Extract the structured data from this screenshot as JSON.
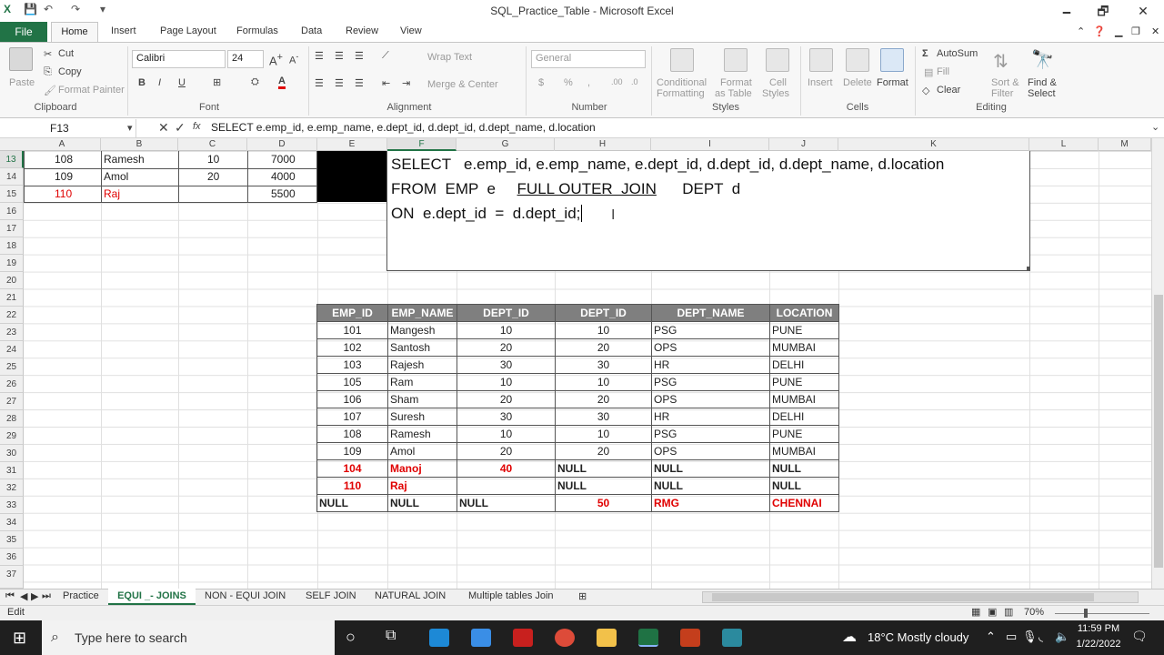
{
  "window": {
    "title": "SQL_Practice_Table - Microsoft Excel",
    "minimize": "🗕",
    "restore": "🗗",
    "close": "✕"
  },
  "ribbon_tabs": [
    "File",
    "Home",
    "Insert",
    "Page Layout",
    "Formulas",
    "Data",
    "Review",
    "View"
  ],
  "clipboard": {
    "paste": "Paste",
    "cut": "Cut",
    "copy": "Copy",
    "format_painter": "Format Painter",
    "label": "Clipboard"
  },
  "font": {
    "name": "Calibri",
    "size": "24",
    "label": "Font"
  },
  "alignment": {
    "wrap_text": "Wrap Text",
    "merge_center": "Merge & Center",
    "label": "Alignment"
  },
  "number": {
    "format": "General",
    "label": "Number"
  },
  "styles": {
    "conditional": "Conditional",
    "conditional2": "Formatting",
    "format_as": "Format",
    "format_as2": "as Table",
    "cell": "Cell",
    "cell2": "Styles",
    "label": "Styles"
  },
  "cells": {
    "insert": "Insert",
    "delete": "Delete",
    "format": "Format",
    "label": "Cells"
  },
  "editing": {
    "autosum": "AutoSum",
    "fill": "Fill",
    "clear": "Clear",
    "sort": "Sort &",
    "sort2": "Filter",
    "find": "Find &",
    "find2": "Select",
    "label": "Editing"
  },
  "formula_bar": {
    "name_box": "F13",
    "formula": "SELECT   e.emp_id, e.emp_name, e.dept_id, d.dept_id, d.dept_name, d.location"
  },
  "columns": [
    "A",
    "B",
    "C",
    "D",
    "E",
    "F",
    "G",
    "H",
    "I",
    "J",
    "K",
    "L",
    "M"
  ],
  "rows": [
    "13",
    "14",
    "15",
    "16",
    "17",
    "18",
    "19",
    "20",
    "21",
    "22",
    "23",
    "24",
    "25",
    "26",
    "27",
    "28",
    "29",
    "30",
    "31",
    "32",
    "33",
    "34",
    "35",
    "36",
    "37"
  ],
  "top_rows": [
    {
      "a": "108",
      "b": "Ramesh",
      "c": "10",
      "d": "7000"
    },
    {
      "a": "109",
      "b": "Amol",
      "c": "20",
      "d": "4000"
    },
    {
      "a": "110",
      "b": "Raj",
      "c": "",
      "d": "5500"
    }
  ],
  "sql": {
    "line1": "SELECT   e.emp_id, e.emp_name, e.dept_id, d.dept_id, d.dept_name, d.location",
    "line2a": "FROM  EMP  e     ",
    "line2b": "FULL OUTER  JOIN",
    "line2c": "      DEPT  d",
    "line3": "ON  e.dept_id  =  d.dept_id;"
  },
  "result_table": {
    "headers": [
      "EMP_ID",
      "EMP_NAME",
      "DEPT_ID",
      "DEPT_ID",
      "DEPT_NAME",
      "LOCATION"
    ],
    "rows": [
      [
        "101",
        "Mangesh",
        "10",
        "10",
        "PSG",
        "PUNE"
      ],
      [
        "102",
        "Santosh",
        "20",
        "20",
        "OPS",
        "MUMBAI"
      ],
      [
        "103",
        "Rajesh",
        "30",
        "30",
        "HR",
        "DELHI"
      ],
      [
        "105",
        "Ram",
        "10",
        "10",
        "PSG",
        "PUNE"
      ],
      [
        "106",
        "Sham",
        "20",
        "20",
        "OPS",
        "MUMBAI"
      ],
      [
        "107",
        "Suresh",
        "30",
        "30",
        "HR",
        "DELHI"
      ],
      [
        "108",
        "Ramesh",
        "10",
        "10",
        "PSG",
        "PUNE"
      ],
      [
        "109",
        "Amol",
        "20",
        "20",
        "OPS",
        "MUMBAI"
      ],
      [
        "104",
        "Manoj",
        "40",
        "NULL",
        "NULL",
        "NULL"
      ],
      [
        "110",
        "Raj",
        "",
        "NULL",
        "NULL",
        "NULL"
      ],
      [
        "NULL",
        "NULL",
        "NULL",
        "50",
        "RMG",
        "CHENNAI"
      ]
    ]
  },
  "sheet_tabs": [
    "Practice",
    "EQUI _- JOINS",
    "NON - EQUI  JOIN",
    "SELF  JOIN",
    "NATURAL JOIN",
    "Multiple tables Join"
  ],
  "status": {
    "mode": "Edit",
    "zoom": "70%"
  },
  "taskbar": {
    "search": "Type here to search",
    "weather": "18°C  Mostly cloudy",
    "time": "11:59 PM",
    "date": "1/22/2022"
  }
}
